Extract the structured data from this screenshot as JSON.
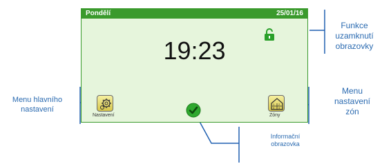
{
  "screen": {
    "day": "Pondělí",
    "date": "25/01/16",
    "time": "19:23",
    "lock_icon": "unlocked-padlock-icon",
    "settings_label": "Nastavení",
    "zones_label": "Zóny",
    "settings_icon": "gears-icon",
    "zones_icon": "house-zones-icon",
    "info_icon": "checkmark-icon"
  },
  "callouts": {
    "lock_line1": "Funkce",
    "lock_line2": "uzamknutí",
    "lock_line3": "obrazovky",
    "menu_line1": "Menu hlavního",
    "menu_line2": "nastavení",
    "zones_line1": "Menu",
    "zones_line2": "nastavení",
    "zones_line3": "zón",
    "info_line1": "Informační",
    "info_line2": "obrazovka"
  },
  "colors": {
    "screen_bg": "#e6f5dc",
    "topbar": "#3a9a2c",
    "callout_text": "#2a6ab0",
    "callout_line": "#1f5fb0"
  }
}
